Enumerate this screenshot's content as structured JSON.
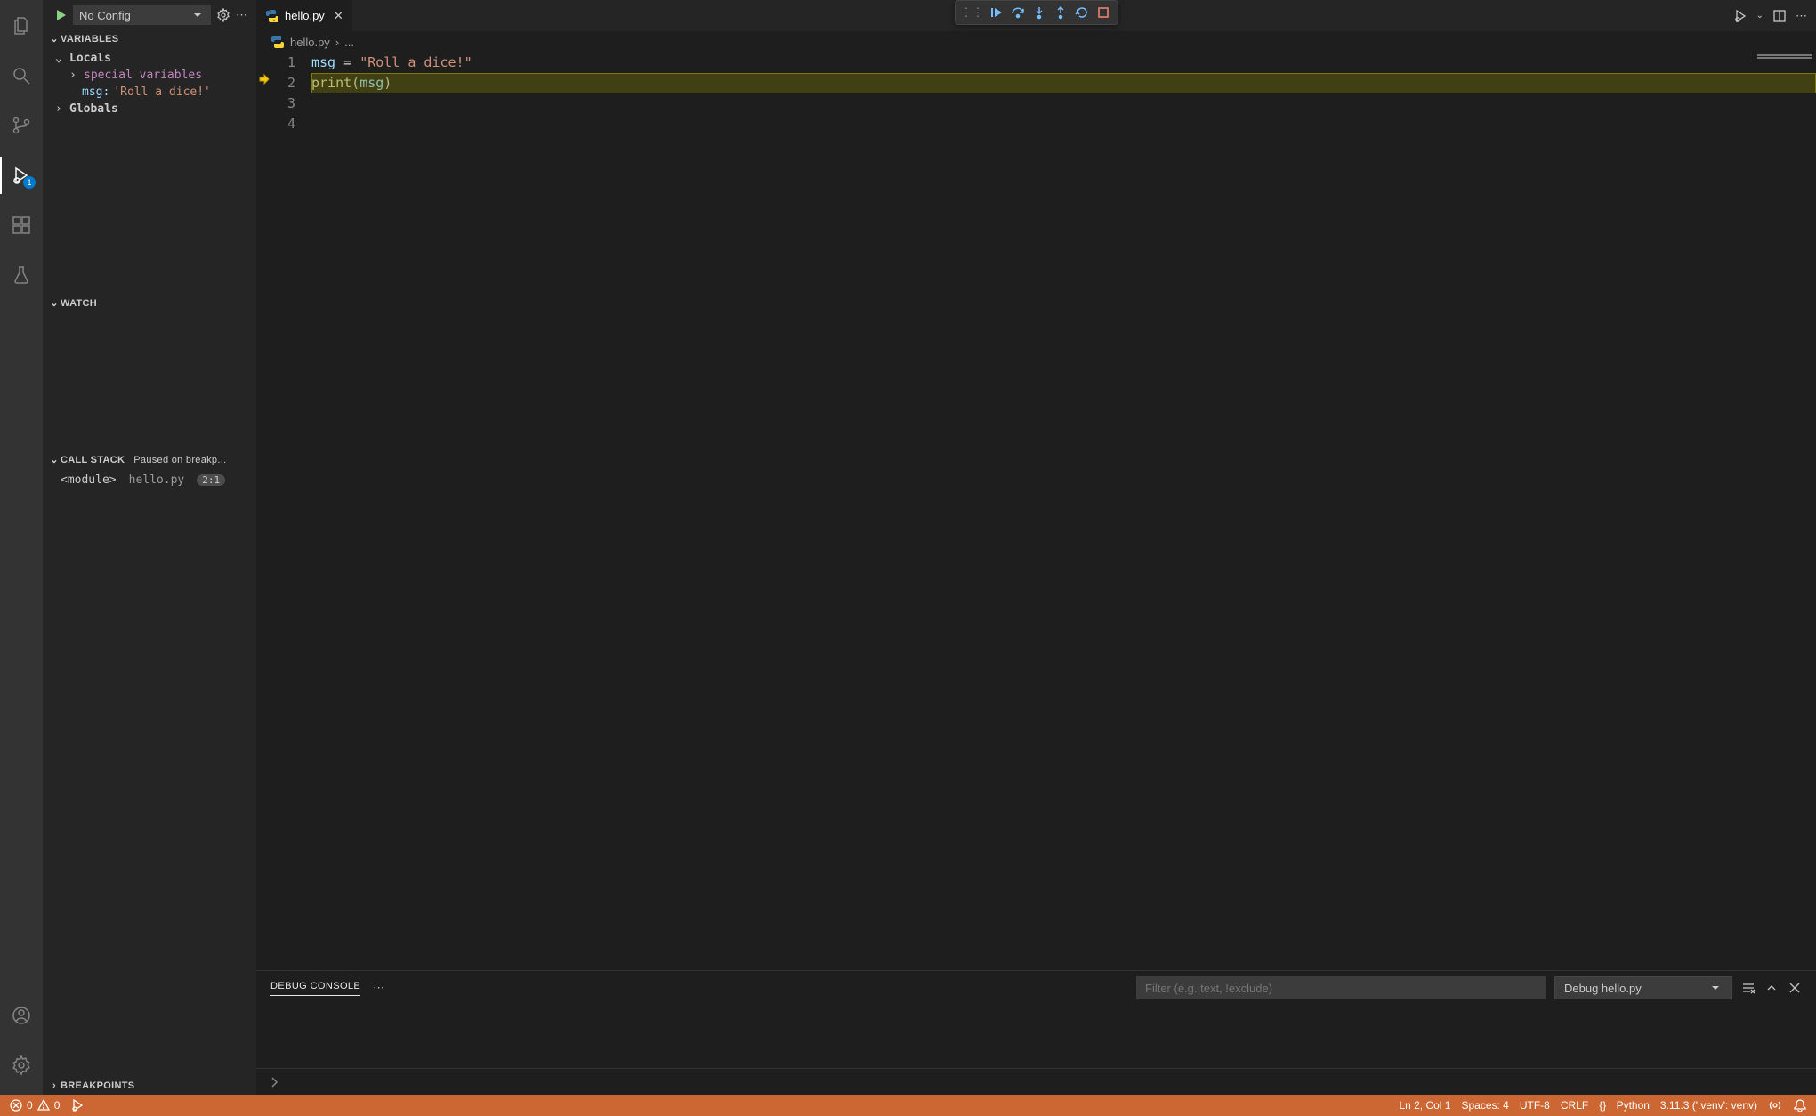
{
  "activity": {
    "debug_badge": "1"
  },
  "sidebar": {
    "config_label": "No Config",
    "sections": {
      "variables": {
        "title": "VARIABLES"
      },
      "locals": {
        "title": "Locals"
      },
      "special": {
        "title": "special variables"
      },
      "msg_var": {
        "name": "msg:",
        "value": "'Roll a dice!'"
      },
      "globals": {
        "title": "Globals"
      },
      "watch": {
        "title": "WATCH"
      },
      "callstack": {
        "title": "CALL STACK",
        "status": "Paused on breakp..."
      },
      "frame": {
        "name": "<module>",
        "file": "hello.py",
        "pos": "2:1"
      },
      "breakpoints": {
        "title": "BREAKPOINTS"
      }
    }
  },
  "tab": {
    "filename": "hello.py"
  },
  "breadcrumb": {
    "file": "hello.py",
    "sep": "›",
    "more": "..."
  },
  "code": {
    "lines": [
      "1",
      "2",
      "3",
      "4"
    ],
    "l1": {
      "a": "msg",
      "b": " = ",
      "c": "\"Roll a dice!\""
    },
    "l2": {
      "a": "print",
      "b": "(",
      "c": "msg",
      "d": ")"
    }
  },
  "panel": {
    "tab": "DEBUG CONSOLE",
    "filter_placeholder": "Filter (e.g. text, !exclude)",
    "session": "Debug hello.py"
  },
  "status": {
    "errors": "0",
    "warnings": "0",
    "position": "Ln 2, Col 1",
    "spaces": "Spaces: 4",
    "encoding": "UTF-8",
    "eol": "CRLF",
    "lang_braces": "{}",
    "lang": "Python",
    "interpreter": "3.11.3 ('.venv': venv)"
  }
}
